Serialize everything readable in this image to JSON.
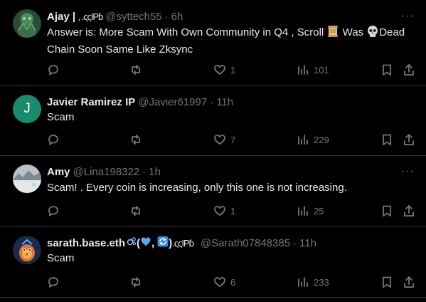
{
  "tweets": [
    {
      "name": "Ajay |",
      "deco": "‚ .ςςIPɓ",
      "handle": "@syttech55",
      "time": "6h",
      "text_a": "Answer is: More Scam With Own Community in Q4 , Scroll ",
      "text_b": " Was ",
      "text_c": "Dead",
      "text_d": "Chain Soon Same Like Zksync",
      "replies": "",
      "reposts": "",
      "likes": "1",
      "views": "101"
    },
    {
      "name": "Javier Ramirez IP",
      "handle": "@Javier61997",
      "time": "11h",
      "avatar_letter": "J",
      "text": "Scam",
      "replies": "",
      "reposts": "",
      "likes": "7",
      "views": "229"
    },
    {
      "name": "Amy",
      "handle": "@Lina198322",
      "time": "1h",
      "text": "Scam! . Every coin is increasing, only this one is not increasing.",
      "replies": "",
      "reposts": "",
      "likes": "1",
      "views": "25"
    },
    {
      "name": "sarath.base.eth",
      "deco": "(",
      "deco2": ",",
      "deco3": ")",
      "deco4": ".ςςIPɓ",
      "handle": "@Sarath07848385",
      "time": "11h",
      "text": "Scam",
      "replies": "",
      "reposts": "",
      "likes": "6",
      "views": "233"
    }
  ],
  "ui": {
    "dot": "·",
    "more": "···"
  },
  "colors": {
    "background": "#000000",
    "text": "#e7e9ea",
    "muted": "#71767b",
    "divider": "#2f3336",
    "avatar_j": "#1a8a6c"
  }
}
